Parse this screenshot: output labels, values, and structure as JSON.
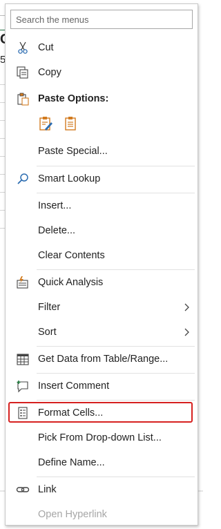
{
  "search": {
    "placeholder": "Search the menus"
  },
  "menu": {
    "cut": "Cut",
    "copy": "Copy",
    "paste_options": "Paste Options:",
    "paste_special": "Paste Special...",
    "smart_lookup": "Smart Lookup",
    "insert": "Insert...",
    "delete": "Delete...",
    "clear_contents": "Clear Contents",
    "quick_analysis": "Quick Analysis",
    "filter": "Filter",
    "sort": "Sort",
    "get_data": "Get Data from Table/Range...",
    "insert_comment": "Insert Comment",
    "format_cells": "Format Cells...",
    "pick_from_dropdown": "Pick From Drop-down List...",
    "define_name": "Define Name...",
    "link": "Link",
    "open_hyperlink": "Open Hyperlink"
  },
  "background": {
    "cell_header": "C",
    "cell_value": "5"
  },
  "colors": {
    "highlight": "#d6201f",
    "icon_orange": "#d27b1f",
    "icon_blue": "#2b6cb0",
    "disabled_text": "#a6a6a6"
  }
}
